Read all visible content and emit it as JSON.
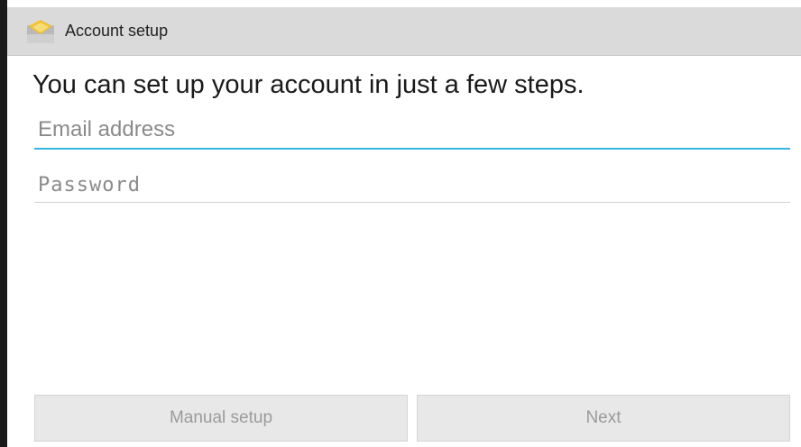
{
  "action_bar": {
    "title": "Account setup",
    "icon": "email-app-icon"
  },
  "main": {
    "headline": "You can set up your account in just a few steps.",
    "email_field": {
      "placeholder": "Email address",
      "value": ""
    },
    "password_field": {
      "placeholder": "Password",
      "value": ""
    }
  },
  "buttons": {
    "manual_setup_label": "Manual setup",
    "next_label": "Next"
  },
  "colors": {
    "action_bar_bg": "#dadada",
    "focus_accent": "#33b5e5",
    "disabled_button_text": "#9b9b9b"
  }
}
